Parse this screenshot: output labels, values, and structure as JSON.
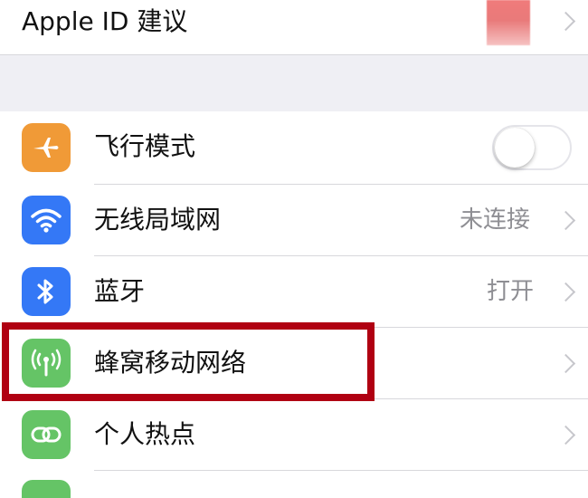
{
  "apple_id_row": {
    "label": "Apple ID 建议"
  },
  "settings": {
    "airplane": {
      "label": "飞行模式",
      "icon": "airplane-icon",
      "icon_color": "#f09a37",
      "toggle_on": false
    },
    "wifi": {
      "label": "无线局域网",
      "value": "未连接",
      "icon": "wifi-icon",
      "icon_color": "#3478f6"
    },
    "bluetooth": {
      "label": "蓝牙",
      "value": "打开",
      "icon": "bluetooth-icon",
      "icon_color": "#3478f6"
    },
    "cellular": {
      "label": "蜂窝移动网络",
      "icon": "cellular-antenna-icon",
      "icon_color": "#65c466"
    },
    "hotspot": {
      "label": "个人热点",
      "icon": "personal-hotspot-icon",
      "icon_color": "#65c466"
    }
  },
  "colors": {
    "highlight_border": "#b00012",
    "group_gap": "#efeff4",
    "secondary_text": "#8e8e93"
  }
}
